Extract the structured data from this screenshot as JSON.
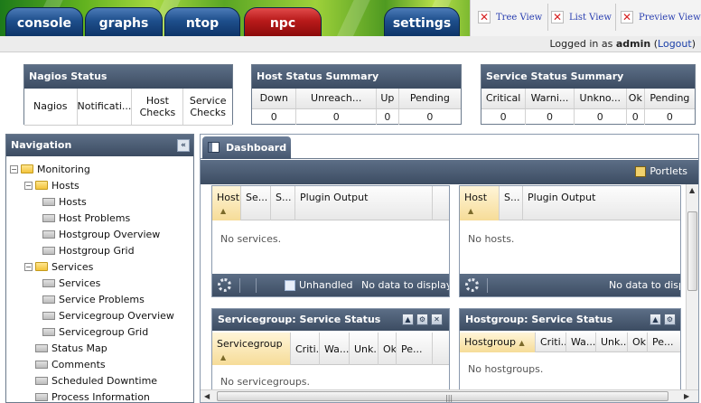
{
  "tabs": [
    {
      "label": "console",
      "style": "blue"
    },
    {
      "label": "graphs",
      "style": "blue"
    },
    {
      "label": "ntop",
      "style": "blue"
    },
    {
      "label": "npc",
      "style": "red"
    },
    {
      "label": "settings",
      "style": "blue"
    }
  ],
  "view_links": [
    {
      "label": "Tree View",
      "icon": "close-x-icon"
    },
    {
      "label": "List View",
      "icon": "close-x-icon"
    },
    {
      "label": "Preview View",
      "icon": "close-x-icon"
    }
  ],
  "login": {
    "prefix": "Logged in as",
    "user": "admin",
    "logout": "Logout"
  },
  "nagios_status": {
    "title": "Nagios Status",
    "columns": [
      "Nagios",
      "Notificati...",
      "Host Checks",
      "Service Checks"
    ]
  },
  "host_status": {
    "title": "Host Status Summary",
    "columns": [
      "Down",
      "Unreach...",
      "Up",
      "Pending"
    ],
    "values": [
      "0",
      "0",
      "0",
      "0"
    ]
  },
  "service_status": {
    "title": "Service Status Summary",
    "columns": [
      "Critical",
      "Warni...",
      "Unkno...",
      "Ok",
      "Pending"
    ],
    "values": [
      "0",
      "0",
      "0",
      "0",
      "0"
    ]
  },
  "navigation": {
    "title": "Navigation",
    "tree": [
      {
        "label": "Monitoring",
        "type": "folder",
        "level": 0,
        "toggle": "−"
      },
      {
        "label": "Hosts",
        "type": "folder",
        "level": 1,
        "toggle": "−"
      },
      {
        "label": "Hosts",
        "type": "leaf",
        "level": 2
      },
      {
        "label": "Host Problems",
        "type": "leaf",
        "level": 2
      },
      {
        "label": "Hostgroup Overview",
        "type": "leaf",
        "level": 2
      },
      {
        "label": "Hostgroup Grid",
        "type": "leaf",
        "level": 2
      },
      {
        "label": "Services",
        "type": "folder",
        "level": 1,
        "toggle": "−"
      },
      {
        "label": "Services",
        "type": "leaf",
        "level": 2
      },
      {
        "label": "Service Problems",
        "type": "leaf",
        "level": 2
      },
      {
        "label": "Servicegroup Overview",
        "type": "leaf",
        "level": 2
      },
      {
        "label": "Servicegroup Grid",
        "type": "leaf",
        "level": 2
      },
      {
        "label": "Status Map",
        "type": "leaf",
        "level": 1
      },
      {
        "label": "Comments",
        "type": "leaf",
        "level": 1
      },
      {
        "label": "Scheduled Downtime",
        "type": "leaf",
        "level": 1
      },
      {
        "label": "Process Information",
        "type": "leaf",
        "level": 1
      }
    ]
  },
  "dashboard": {
    "tab_label": "Dashboard",
    "portlets_label": "Portlets",
    "service_grid": {
      "columns": [
        "Host",
        "Se...",
        "S...",
        "Plugin Output"
      ],
      "empty_text": "No services.",
      "unhandled_label": "Unhandled",
      "no_data": "No data to display"
    },
    "host_grid": {
      "columns": [
        "Host",
        "S...",
        "Plugin Output"
      ],
      "empty_text": "No hosts.",
      "no_data": "No data to displa"
    },
    "servicegroup_portlet": {
      "title": "Servicegroup: Service Status",
      "columns": [
        "Servicegroup",
        "Criti...",
        "Wa...",
        "Unk...",
        "Ok",
        "Pe..."
      ],
      "empty_text": "No servicegroups."
    },
    "hostgroup_portlet": {
      "title": "Hostgroup: Service Status",
      "columns": [
        "Hostgroup",
        "Criti...",
        "Wa...",
        "Unk...",
        "Ok",
        "Pe..."
      ],
      "empty_text": "No hostgroups."
    }
  }
}
